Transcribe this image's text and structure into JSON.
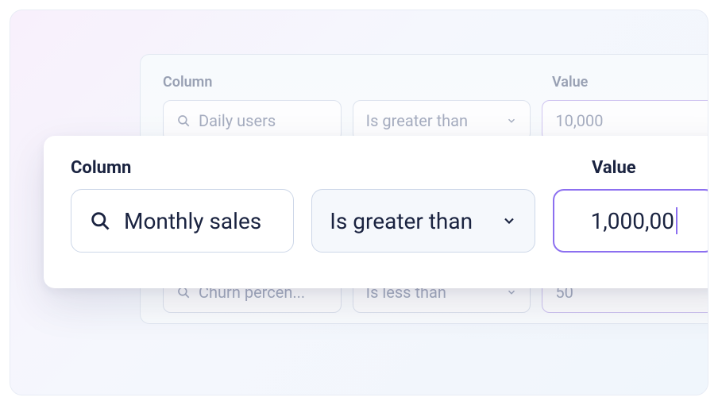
{
  "labels": {
    "column": "Column",
    "value": "Value"
  },
  "background": {
    "rows": [
      {
        "column": "Daily users",
        "operator": "Is greater than",
        "value": "10,000"
      },
      {
        "column": "Churn percen...",
        "operator": "Is less than",
        "value": "50"
      }
    ]
  },
  "foreground": {
    "column": "Monthly sales",
    "operator": "Is greater than",
    "value": "1,000,00"
  }
}
